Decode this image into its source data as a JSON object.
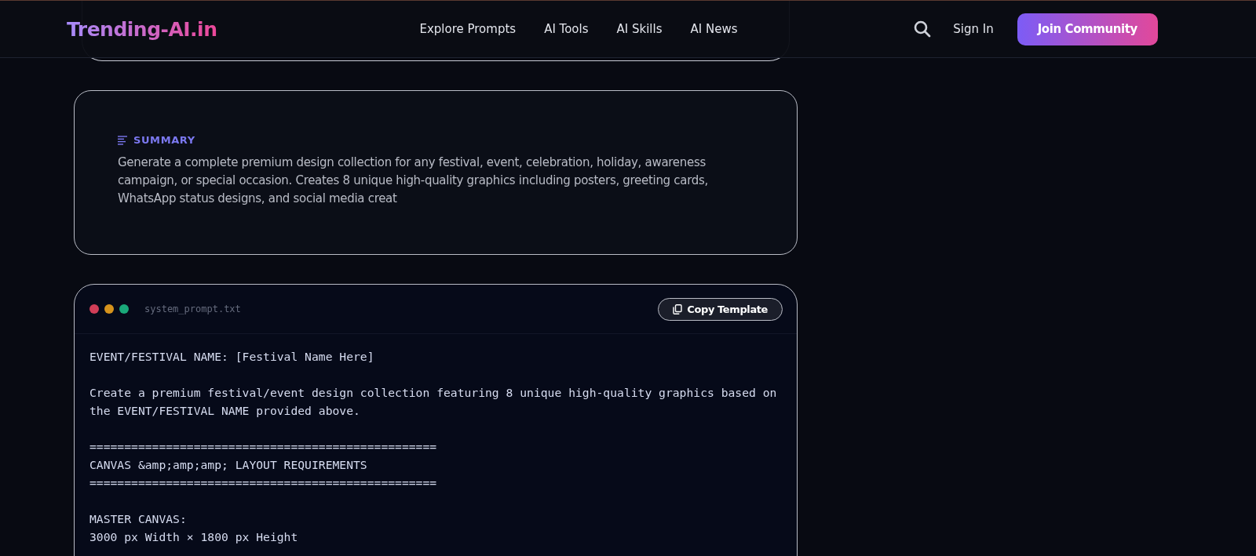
{
  "header": {
    "logo": "Trending-AI.in",
    "nav": [
      {
        "label": "Explore Prompts"
      },
      {
        "label": "AI Tools"
      },
      {
        "label": "AI Skills"
      },
      {
        "label": "AI News"
      }
    ],
    "sign_in": "Sign In",
    "join": "Join Community"
  },
  "summary": {
    "heading": "SUMMARY",
    "text": "Generate a complete premium design collection for any festival, event, celebration, holiday, awareness campaign, or special occasion. Creates 8 unique high-quality graphics including posters, greeting cards, WhatsApp status designs, and social media creat"
  },
  "code_card": {
    "filename": "system_prompt.txt",
    "copy_button": "Copy Template",
    "blocks": [
      [
        "EVENT/FESTIVAL NAME: [Festival Name Here]"
      ],
      [
        "Create a premium festival/event design collection featuring 8 unique high-quality graphics based on the EVENT/FESTIVAL NAME provided above."
      ],
      [
        "==================================================",
        "CANVAS &amp;amp;amp; LAYOUT REQUIREMENTS",
        "=================================================="
      ],
      [
        "MASTER CANVAS:",
        "3000 px Width × 1800 px Height"
      ]
    ]
  }
}
